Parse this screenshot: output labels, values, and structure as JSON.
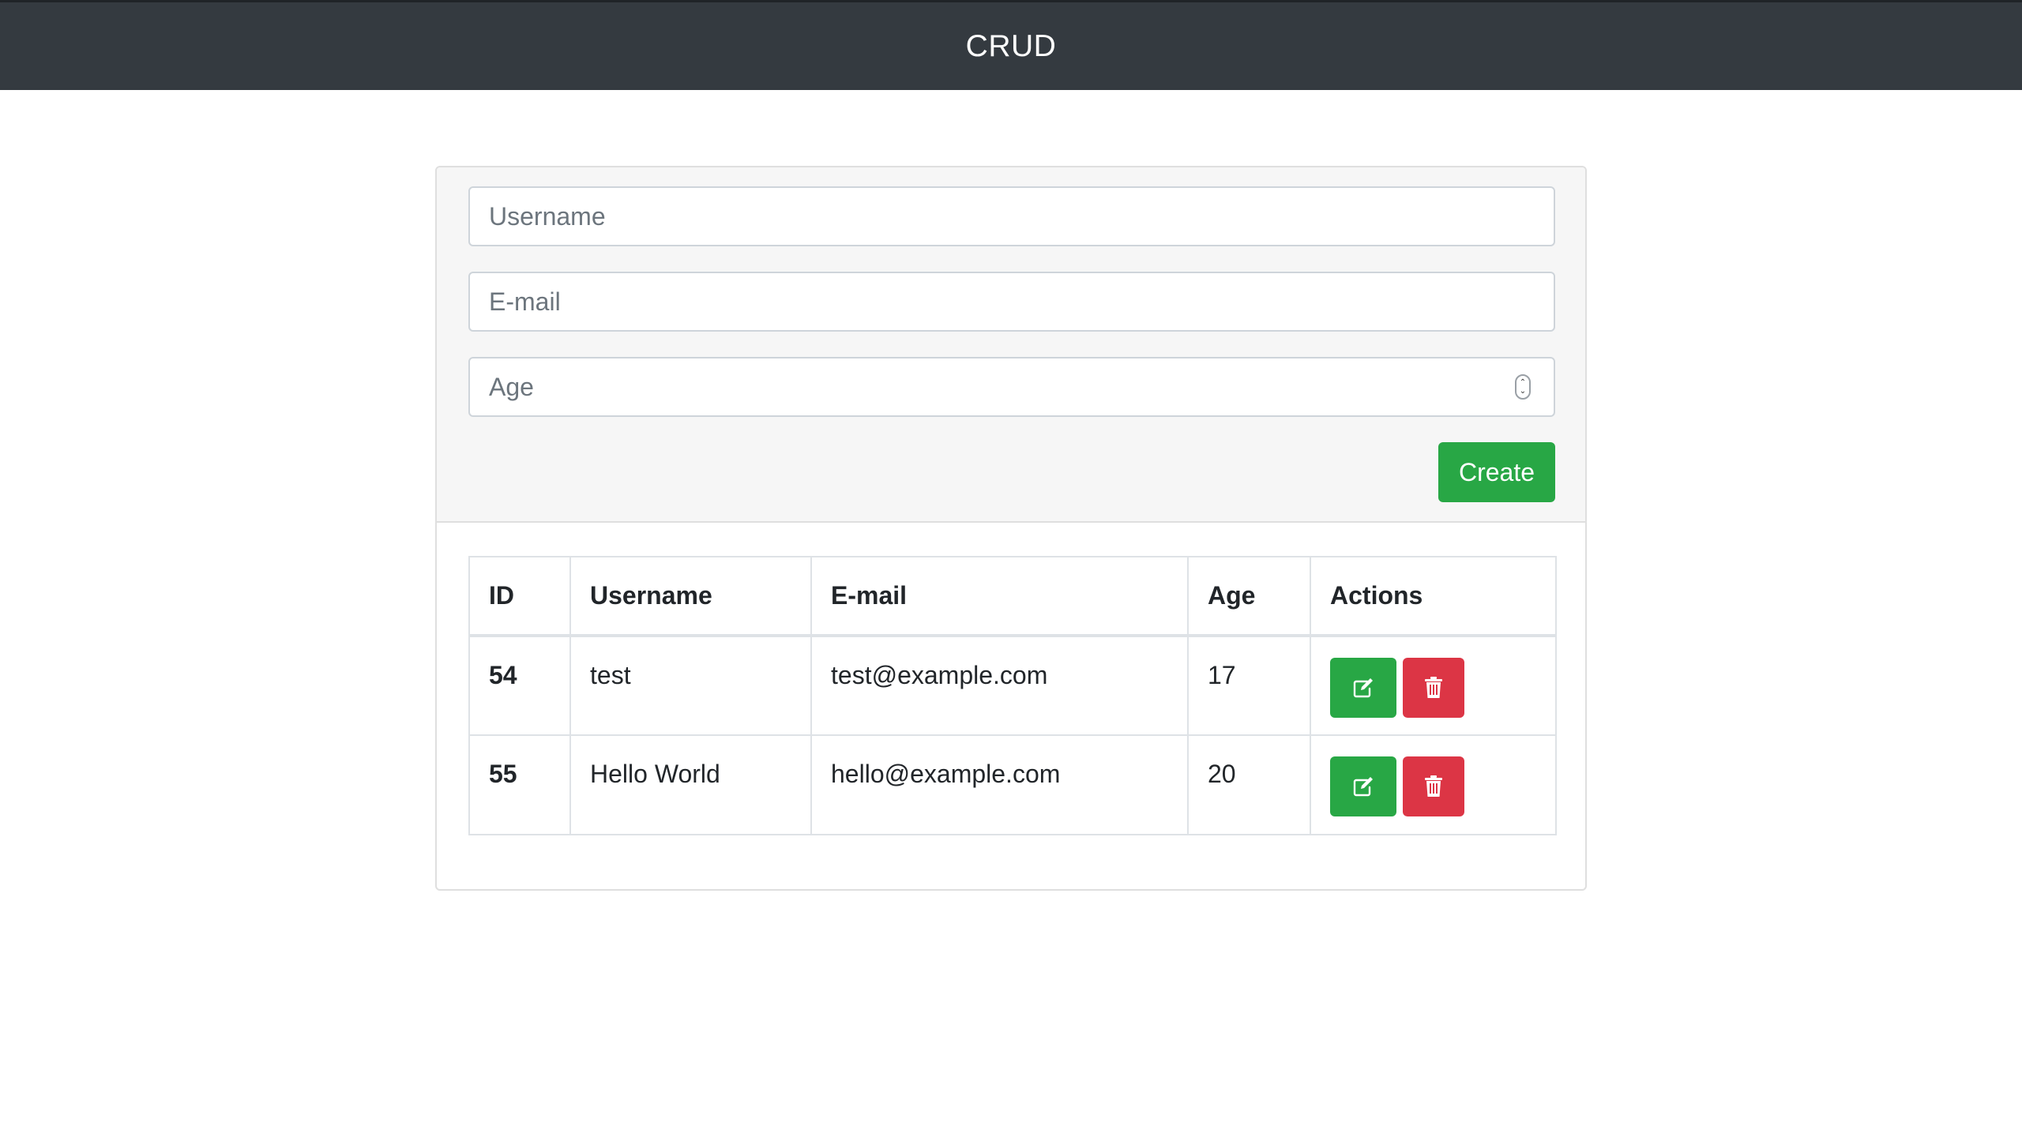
{
  "navbar": {
    "title": "CRUD"
  },
  "form": {
    "username_placeholder": "Username",
    "email_placeholder": "E-mail",
    "age_placeholder": "Age",
    "spinner_up": "⌃",
    "spinner_down": "⌄",
    "create_label": "Create"
  },
  "table": {
    "headers": [
      "ID",
      "Username",
      "E-mail",
      "Age",
      "Actions"
    ],
    "rows": [
      {
        "id": "54",
        "username": "test",
        "email": "test@example.com",
        "age": "17"
      },
      {
        "id": "55",
        "username": "Hello World",
        "email": "hello@example.com",
        "age": "20"
      }
    ]
  },
  "icons": {
    "edit": "edit-icon",
    "delete": "trash-icon"
  },
  "colors": {
    "navbar": "#343a40",
    "success": "#28a745",
    "danger": "#dc3545",
    "header_bg": "#f6f6f6"
  }
}
